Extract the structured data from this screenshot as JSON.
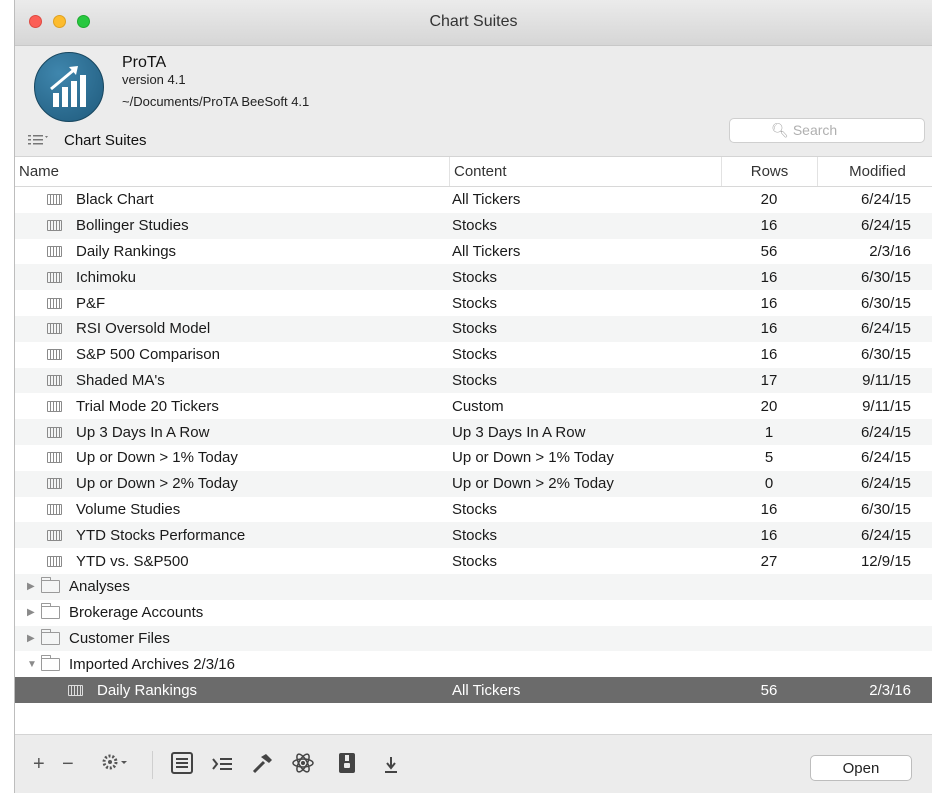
{
  "window": {
    "title": "Chart Suites"
  },
  "app": {
    "name": "ProTA",
    "version": "version 4.1",
    "path": "~/Documents/ProTA BeeSoft 4.1"
  },
  "toolbar": {
    "section_label": "Chart Suites",
    "search_placeholder": "Search"
  },
  "table": {
    "columns": {
      "name": "Name",
      "content": "Content",
      "rows": "Rows",
      "modified": "Modified"
    },
    "items": [
      {
        "name": "Black Chart",
        "content": "All Tickers",
        "rows": "20",
        "modified": "6/24/15"
      },
      {
        "name": "Bollinger Studies",
        "content": "Stocks",
        "rows": "16",
        "modified": "6/24/15"
      },
      {
        "name": "Daily Rankings",
        "content": "All Tickers",
        "rows": "56",
        "modified": "2/3/16"
      },
      {
        "name": "Ichimoku",
        "content": "Stocks",
        "rows": "16",
        "modified": "6/30/15"
      },
      {
        "name": "P&F",
        "content": "Stocks",
        "rows": "16",
        "modified": "6/30/15"
      },
      {
        "name": "RSI Oversold Model",
        "content": "Stocks",
        "rows": "16",
        "modified": "6/24/15"
      },
      {
        "name": "S&P 500 Comparison",
        "content": "Stocks",
        "rows": "16",
        "modified": "6/30/15"
      },
      {
        "name": "Shaded MA's",
        "content": "Stocks",
        "rows": "17",
        "modified": "9/11/15"
      },
      {
        "name": "Trial Mode 20 Tickers",
        "content": "Custom",
        "rows": "20",
        "modified": "9/11/15"
      },
      {
        "name": "Up 3 Days In A Row",
        "content": "Up 3 Days In A Row",
        "rows": "1",
        "modified": "6/24/15"
      },
      {
        "name": "Up or Down > 1% Today",
        "content": "Up or Down > 1% Today",
        "rows": "5",
        "modified": "6/24/15"
      },
      {
        "name": "Up or Down > 2% Today",
        "content": "Up or Down > 2% Today",
        "rows": "0",
        "modified": "6/24/15"
      },
      {
        "name": "Volume Studies",
        "content": "Stocks",
        "rows": "16",
        "modified": "6/30/15"
      },
      {
        "name": "YTD Stocks Performance",
        "content": "Stocks",
        "rows": "16",
        "modified": "6/24/15"
      },
      {
        "name": "YTD vs. S&P500",
        "content": "Stocks",
        "rows": "27",
        "modified": "12/9/15"
      }
    ],
    "folders": [
      {
        "name": "Analyses",
        "disclosure": "▶"
      },
      {
        "name": "Brokerage Accounts",
        "disclosure": "▶"
      },
      {
        "name": "Customer Files",
        "disclosure": "▶"
      },
      {
        "name": "Imported Archives 2/3/16",
        "disclosure": "▼"
      }
    ],
    "selected": {
      "name": "Daily Rankings",
      "content": "All Tickers",
      "rows": "56",
      "modified": "2/3/16"
    }
  },
  "footer": {
    "add": "+",
    "remove": "−",
    "open_label": "Open"
  }
}
